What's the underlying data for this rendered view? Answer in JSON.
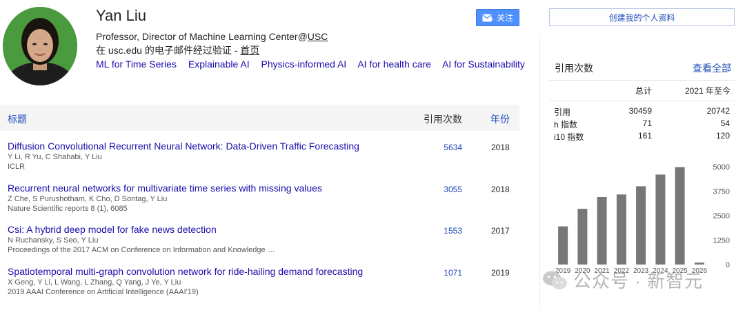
{
  "profile": {
    "name": "Yan Liu",
    "affiliation_prefix": "Professor, Director of Machine Learning Center@",
    "affiliation_org": "USC",
    "verified_text": "在 usc.edu 的电子邮件经过验证 - ",
    "homepage_label": "首页",
    "interests": [
      "ML for Time Series",
      "Explainable AI",
      "Physics-informed AI",
      "AI for health care",
      "AI for Sustainability"
    ]
  },
  "actions": {
    "follow_label": "关注",
    "create_profile_label": "创建我的个人资料"
  },
  "table": {
    "col_title": "标题",
    "col_cites": "引用次数",
    "col_year": "年份",
    "rows": [
      {
        "title": "Diffusion Convolutional Recurrent Neural Network: Data-Driven Traffic Forecasting",
        "authors": "Y Li, R Yu, C Shahabi, Y Liu",
        "venue": "ICLR",
        "cites": "5634",
        "year": "2018"
      },
      {
        "title": "Recurrent neural networks for multivariate time series with missing values",
        "authors": "Z Che, S Purushotham, K Cho, D Sontag, Y Liu",
        "venue": "Nature Scientific reports 8 (1), 6085",
        "cites": "3055",
        "year": "2018"
      },
      {
        "title": "Csi: A hybrid deep model for fake news detection",
        "authors": "N Ruchansky, S Seo, Y Liu",
        "venue": "Proceedings of the 2017 ACM on Conference on Information and Knowledge …",
        "cites": "1553",
        "year": "2017"
      },
      {
        "title": "Spatiotemporal multi-graph convolution network for ride-hailing demand forecasting",
        "authors": "X Geng, Y Li, L Wang, L Zhang, Q Yang, J Ye, Y Liu",
        "venue": "2019 AAAI Conference on Artificial Intelligence (AAAI'19)",
        "cites": "1071",
        "year": "2019"
      }
    ]
  },
  "stats": {
    "title": "引用次数",
    "view_all": "查看全部",
    "col_total": "总计",
    "col_since": "2021 年至今",
    "rows": [
      {
        "label": "引用",
        "total": "30459",
        "since": "20742"
      },
      {
        "label": "h 指数",
        "total": "71",
        "since": "54"
      },
      {
        "label": "i10 指数",
        "total": "161",
        "since": "120"
      }
    ]
  },
  "chart_data": {
    "type": "bar",
    "categories": [
      "2019",
      "2020",
      "2021",
      "2022",
      "2023",
      "2024",
      "2025",
      "2026"
    ],
    "values": [
      1950,
      2850,
      3450,
      3580,
      4000,
      4600,
      4980,
      100
    ],
    "y_ticks": [
      0,
      1250,
      2500,
      3750,
      5000
    ],
    "ylim": [
      0,
      5000
    ],
    "bar_color": "#777777",
    "grid": false
  },
  "watermark": {
    "text": "公众号 · 新智元"
  },
  "colors": {
    "link": "#1a0dab",
    "accent": "#1a47b8",
    "follow_button": "#4d90fe"
  }
}
